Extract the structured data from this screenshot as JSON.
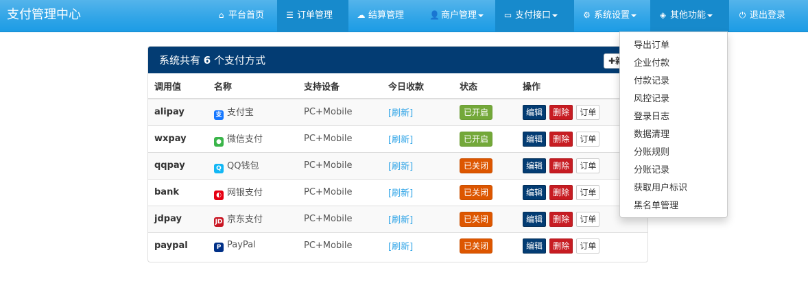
{
  "brand": "支付管理中心",
  "nav": [
    {
      "icon": "home-icon",
      "glyph": "⌂",
      "label": "平台首页",
      "active": false,
      "caret": false
    },
    {
      "icon": "list-icon",
      "glyph": "☰",
      "label": "订单管理",
      "active": true,
      "caret": false
    },
    {
      "icon": "cloud-icon",
      "glyph": "☁",
      "label": "结算管理",
      "active": false,
      "caret": false
    },
    {
      "icon": "user-icon",
      "glyph": "👤",
      "label": "商户管理",
      "active": false,
      "caret": true
    },
    {
      "icon": "credit-card-icon",
      "glyph": "▭",
      "label": "支付接口",
      "active": true,
      "caret": true
    },
    {
      "icon": "gear-icon",
      "glyph": "⚙",
      "label": "系统设置",
      "active": false,
      "caret": true
    },
    {
      "icon": "cube-icon",
      "glyph": "◈",
      "label": "其他功能",
      "active": true,
      "caret": true
    },
    {
      "icon": "power-icon",
      "glyph": "⏻",
      "label": "退出登录",
      "active": false,
      "caret": false
    }
  ],
  "panel": {
    "title_prefix": "系统共有",
    "count": "6",
    "title_suffix": "个支付方式",
    "add_label": "新"
  },
  "table": {
    "headers": [
      "调用值",
      "名称",
      "支持设备",
      "今日收款",
      "状态",
      "操作"
    ],
    "rows": [
      {
        "code": "alipay",
        "name": "支付宝",
        "logo": "alipay-logo",
        "logo_color": "#1677ff",
        "logo_glyph": "支",
        "device": "PC+Mobile",
        "today": "[刷新]",
        "status": "已开启",
        "enabled": true
      },
      {
        "code": "wxpay",
        "name": "微信支付",
        "logo": "wechat-logo",
        "logo_color": "#3bb54a",
        "logo_glyph": "●",
        "device": "PC+Mobile",
        "today": "[刷新]",
        "status": "已开启",
        "enabled": true
      },
      {
        "code": "qqpay",
        "name": "QQ钱包",
        "logo": "qq-logo",
        "logo_color": "#12b7f5",
        "logo_glyph": "Q",
        "device": "PC+Mobile",
        "today": "[刷新]",
        "status": "已关闭",
        "enabled": false
      },
      {
        "code": "bank",
        "name": "网银支付",
        "logo": "unionpay-logo",
        "logo_color": "#e60012",
        "logo_glyph": "◐",
        "device": "PC+Mobile",
        "today": "[刷新]",
        "status": "已关闭",
        "enabled": false
      },
      {
        "code": "jdpay",
        "name": "京东支付",
        "logo": "jd-logo",
        "logo_color": "#c91623",
        "logo_glyph": "JD",
        "device": "PC+Mobile",
        "today": "[刷新]",
        "status": "已关闭",
        "enabled": false
      },
      {
        "code": "paypal",
        "name": "PayPal",
        "logo": "paypal-logo",
        "logo_color": "#003087",
        "logo_glyph": "P",
        "device": "PC+Mobile",
        "today": "[刷新]",
        "status": "已关闭",
        "enabled": false
      }
    ],
    "ops": {
      "edit": "编辑",
      "delete": "删除",
      "orders": "订单"
    }
  },
  "dropdown": {
    "items": [
      "导出订单",
      "企业付款",
      "付款记录",
      "风控记录",
      "登录日志",
      "数据清理",
      "分账规则",
      "分账记录",
      "获取用户标识",
      "黑名单管理"
    ]
  },
  "colors": {
    "navbar": "#2fa4e7",
    "nav_active": "#178acc",
    "panel_heading": "#033c73",
    "status_on": "#73a839",
    "status_off": "#dd5600",
    "edit": "#033c73",
    "delete": "#c71c22"
  }
}
